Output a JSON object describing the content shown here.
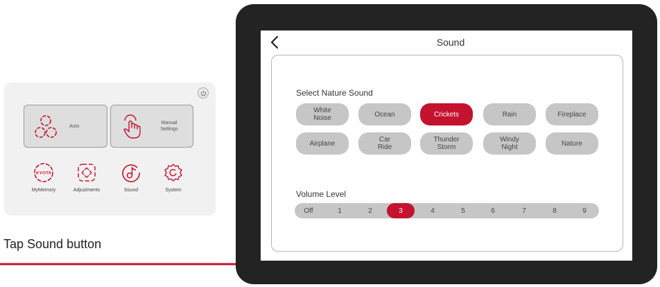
{
  "home": {
    "modes": [
      {
        "label": "Auto",
        "icon": "auto-dots-icon"
      },
      {
        "label": "Manual\nSettings",
        "icon": "hand-tap-icon"
      }
    ],
    "items": [
      {
        "label": "MyMemory",
        "icon": "kyota-logo-icon"
      },
      {
        "label": "Adjustments",
        "icon": "adjust-arrows-icon"
      },
      {
        "label": "Sound",
        "icon": "music-note-icon"
      },
      {
        "label": "System",
        "icon": "gear-icon"
      }
    ]
  },
  "caption": "Tap Sound button",
  "screen": {
    "title": "Sound",
    "nature_label": "Select Nature Sound",
    "sounds": [
      {
        "label": "White\nNoise",
        "active": false
      },
      {
        "label": "Ocean",
        "active": false
      },
      {
        "label": "Crickets",
        "active": true
      },
      {
        "label": "Rain",
        "active": false
      },
      {
        "label": "Fireplace",
        "active": false
      },
      {
        "label": "Airplane",
        "active": false
      },
      {
        "label": "Car\nRide",
        "active": false
      },
      {
        "label": "Thunder\nStorm",
        "active": false
      },
      {
        "label": "Windy\nNight",
        "active": false
      },
      {
        "label": "Nature",
        "active": false
      }
    ],
    "volume_label": "Volume Level",
    "volume_steps": [
      "Off",
      "1",
      "2",
      "3",
      "4",
      "5",
      "6",
      "7",
      "8",
      "9"
    ],
    "volume_selected": "3"
  },
  "colors": {
    "accent": "#c4122f",
    "pill": "#c6c6c6",
    "bezel": "#232323"
  }
}
